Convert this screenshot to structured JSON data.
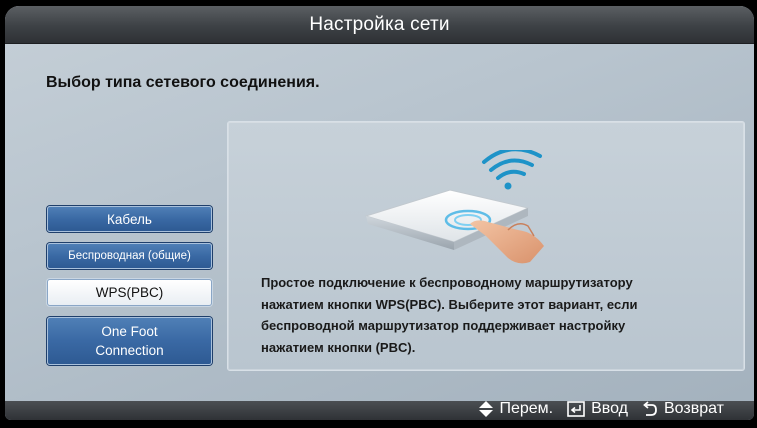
{
  "window": {
    "title": "Настройка сети"
  },
  "prompt": "Выбор типа сетевого соединения.",
  "options": [
    {
      "label": "Кабель",
      "selected": false
    },
    {
      "label": "Беспроводная (общие)",
      "selected": false
    },
    {
      "label": "WPS(PBC)",
      "selected": true
    },
    {
      "label": "One Foot\nConnection",
      "selected": false
    }
  ],
  "description": "Простое подключение к беспроводному маршрутизатору\nнажатием кнопки WPS(PBC). Выберите этот вариант, если\nбеспроводной маршрутизатор поддерживает настройку\nнажатием кнопки (PBC).",
  "footer": {
    "move_label": "Перем.",
    "enter_label": "Ввод",
    "back_label": "Возврат"
  },
  "icons": {
    "move": "up-down-arrows-icon",
    "enter": "enter-key-icon",
    "back": "return-icon"
  },
  "colors": {
    "button": "#3a69a4",
    "selected_button": "#ffffff",
    "title_bar": "#3d4145",
    "wifi": "#1e93c8"
  }
}
